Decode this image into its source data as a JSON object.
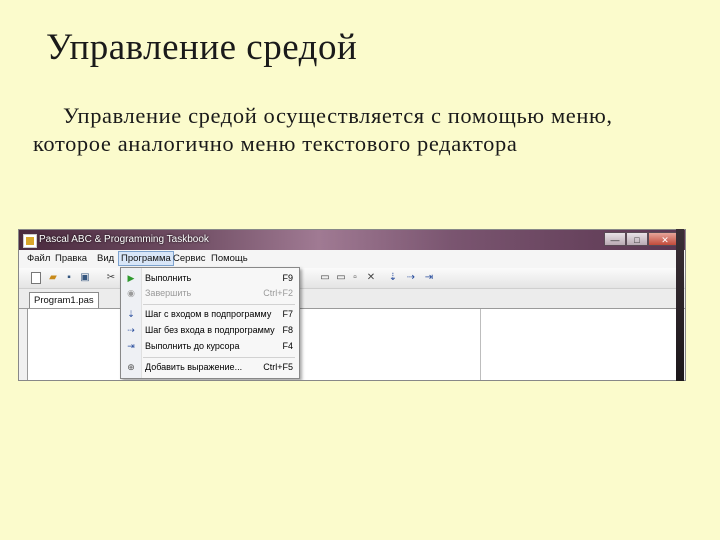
{
  "slide": {
    "title": "Управление средой",
    "body": "Управление средой осуществляется с помощью меню, которое аналогично меню текстового редактора"
  },
  "window": {
    "title": "Pascal ABC & Programming Taskbook",
    "controls": [
      "—",
      "□",
      "✕"
    ]
  },
  "menubar": {
    "items": [
      "Файл",
      "Правка",
      "Вид",
      "Программа",
      "Сервис",
      "Помощь"
    ],
    "active_index": 3
  },
  "toolbar": {
    "icons": [
      "new-file-icon",
      "open-folder-icon",
      "save-icon",
      "save-all-icon",
      "cut-icon",
      "window-icon",
      "window-icon",
      "close-icon",
      "step-into-icon",
      "step-over-icon",
      "run-to-cursor-icon"
    ]
  },
  "tab": {
    "label": "Program1.pas"
  },
  "dropdown": {
    "items": [
      {
        "label": "Выполнить",
        "shortcut": "F9",
        "icon": "run-icon",
        "enabled": true
      },
      {
        "label": "Завершить",
        "shortcut": "Ctrl+F2",
        "icon": "stop-icon",
        "enabled": false
      },
      {
        "label": "Шаг с входом в подпрограмму",
        "shortcut": "F7",
        "icon": "step-into-icon",
        "enabled": true
      },
      {
        "label": "Шаг без входа в подпрограмму",
        "shortcut": "F8",
        "icon": "step-over-icon",
        "enabled": true
      },
      {
        "label": "Выполнить до курсора",
        "shortcut": "F4",
        "icon": "run-to-cursor-icon",
        "enabled": true
      },
      {
        "label": "Добавить выражение...",
        "shortcut": "Ctrl+F5",
        "icon": "add-watch-icon",
        "enabled": true
      }
    ]
  },
  "colors": {
    "slide_background": "#fbfbcc",
    "menu_highlight": "#d8e6f8"
  }
}
